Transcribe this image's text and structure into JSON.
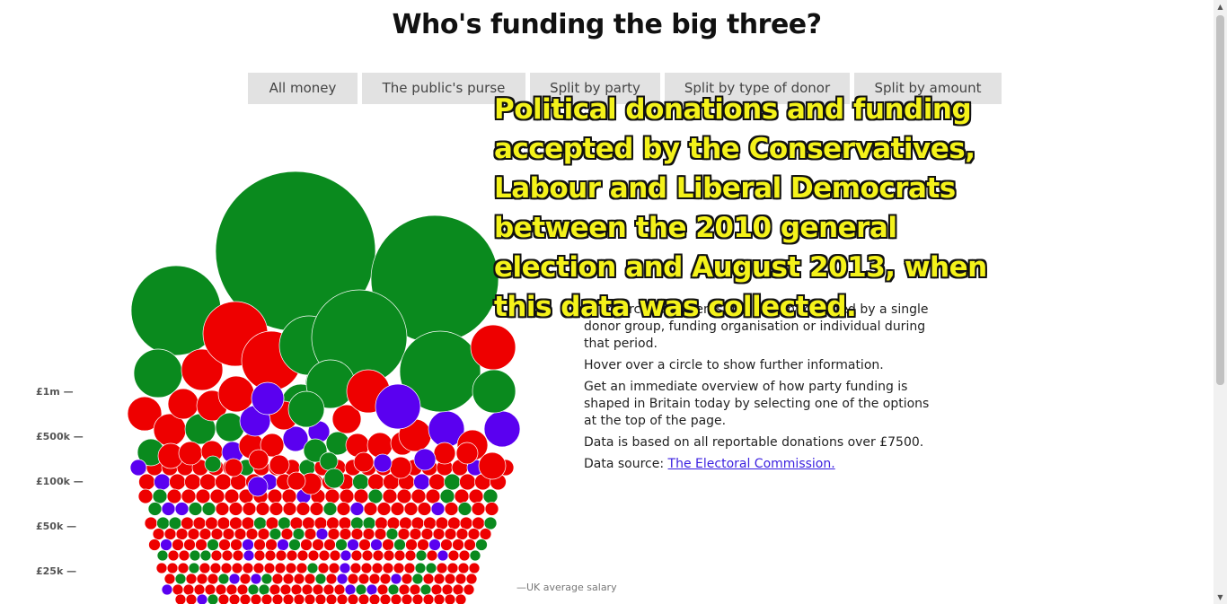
{
  "title": "Who's funding the big three?",
  "tabs": [
    {
      "label": "All money"
    },
    {
      "label": "The public's purse"
    },
    {
      "label": "Split by party"
    },
    {
      "label": "Split by type of donor"
    },
    {
      "label": "Split by amount"
    }
  ],
  "overlay_title": "Political donations and funding accepted by the Conservatives, Labour and Liberal Democrats between the 2010 general election and August 2013, when this data was collected.",
  "info": {
    "p1": "Each circle represents the amount donated by a single donor group, funding organisation or individual during that period.",
    "p2": "Hover over a circle to show further information.",
    "p3": "Get an immediate overview of how party funding is shaped in Britain today by selecting one of the options at the top of the page.",
    "p4": "Data is based on all reportable donations over £7500.",
    "source_prefix": "Data source: ",
    "source_link": "The Electoral Commission."
  },
  "scale_labels": [
    "£1m —",
    "£500k —",
    "£100k —",
    "£50k —",
    "£25k —"
  ],
  "salary_label": "—UK average salary",
  "colors": {
    "conservative": "#0a8a1e",
    "labour": "#ee0000",
    "libdem": "#5a00f0"
  }
}
